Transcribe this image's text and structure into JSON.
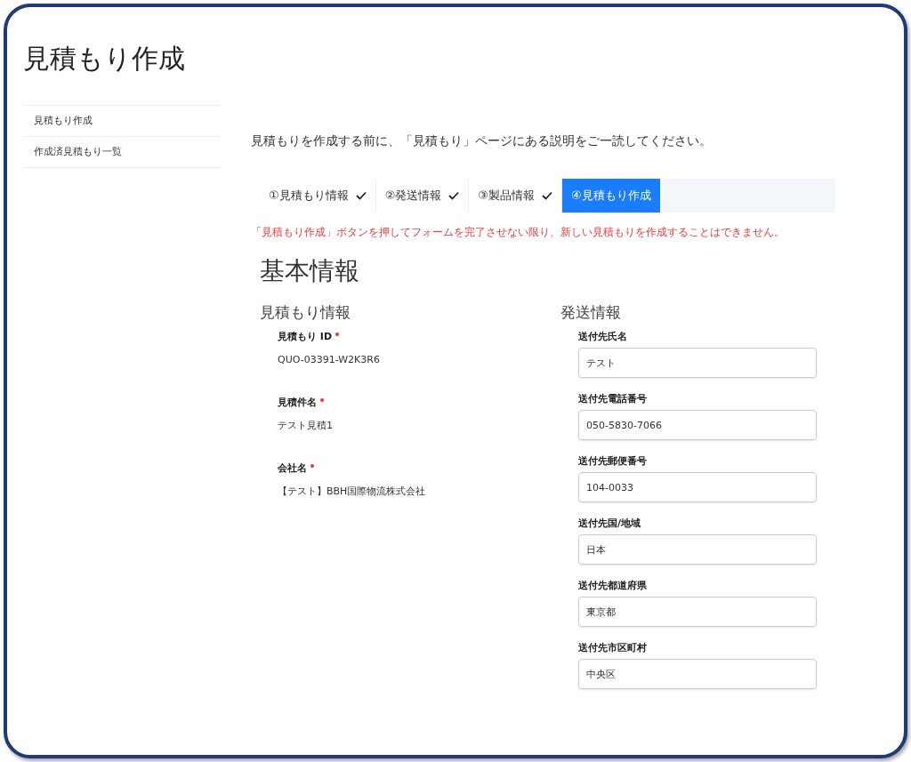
{
  "page_title": "見積もり作成",
  "sidebar": {
    "items": [
      {
        "label": "見積もり作成",
        "selected": false
      },
      {
        "label": "作成済見積もり一覧",
        "selected": false
      }
    ]
  },
  "intro": "見積もりを作成する前に、「見積もり」ページにある説明をご一読してください。",
  "steps": [
    {
      "label": "①見積もり情報",
      "completed": true,
      "selected": false
    },
    {
      "label": "②発送情報",
      "completed": true,
      "selected": false
    },
    {
      "label": "③製品情報",
      "completed": true,
      "selected": false
    },
    {
      "label": "④見積もり作成",
      "completed": false,
      "selected": true
    }
  ],
  "warning": "「見積もり作成」ボタンを押してフォームを完了させない限り、新しい見積もりを作成することはできません。",
  "section_title": "基本情報",
  "quote_info": {
    "title": "見積もり情報",
    "fields": [
      {
        "label": "見積もり ID",
        "required": true,
        "value": "QUO-03391-W2K3R6"
      },
      {
        "label": "見積件名",
        "required": true,
        "value": "テスト見積1"
      },
      {
        "label": "会社名",
        "required": true,
        "value": "【テスト】BBH国際物流株式会社"
      }
    ]
  },
  "shipping_info": {
    "title": "発送情報",
    "fields": [
      {
        "label": "送付先氏名",
        "value": "テスト"
      },
      {
        "label": "送付先電話番号",
        "value": "050-5830-7066"
      },
      {
        "label": "送付先郵便番号",
        "value": "104-0033"
      },
      {
        "label": "送付先国/地域",
        "value": "日本"
      },
      {
        "label": "送付先都道府県",
        "value": "東京都"
      },
      {
        "label": "送付先市区町村",
        "value": "中央区"
      }
    ]
  }
}
